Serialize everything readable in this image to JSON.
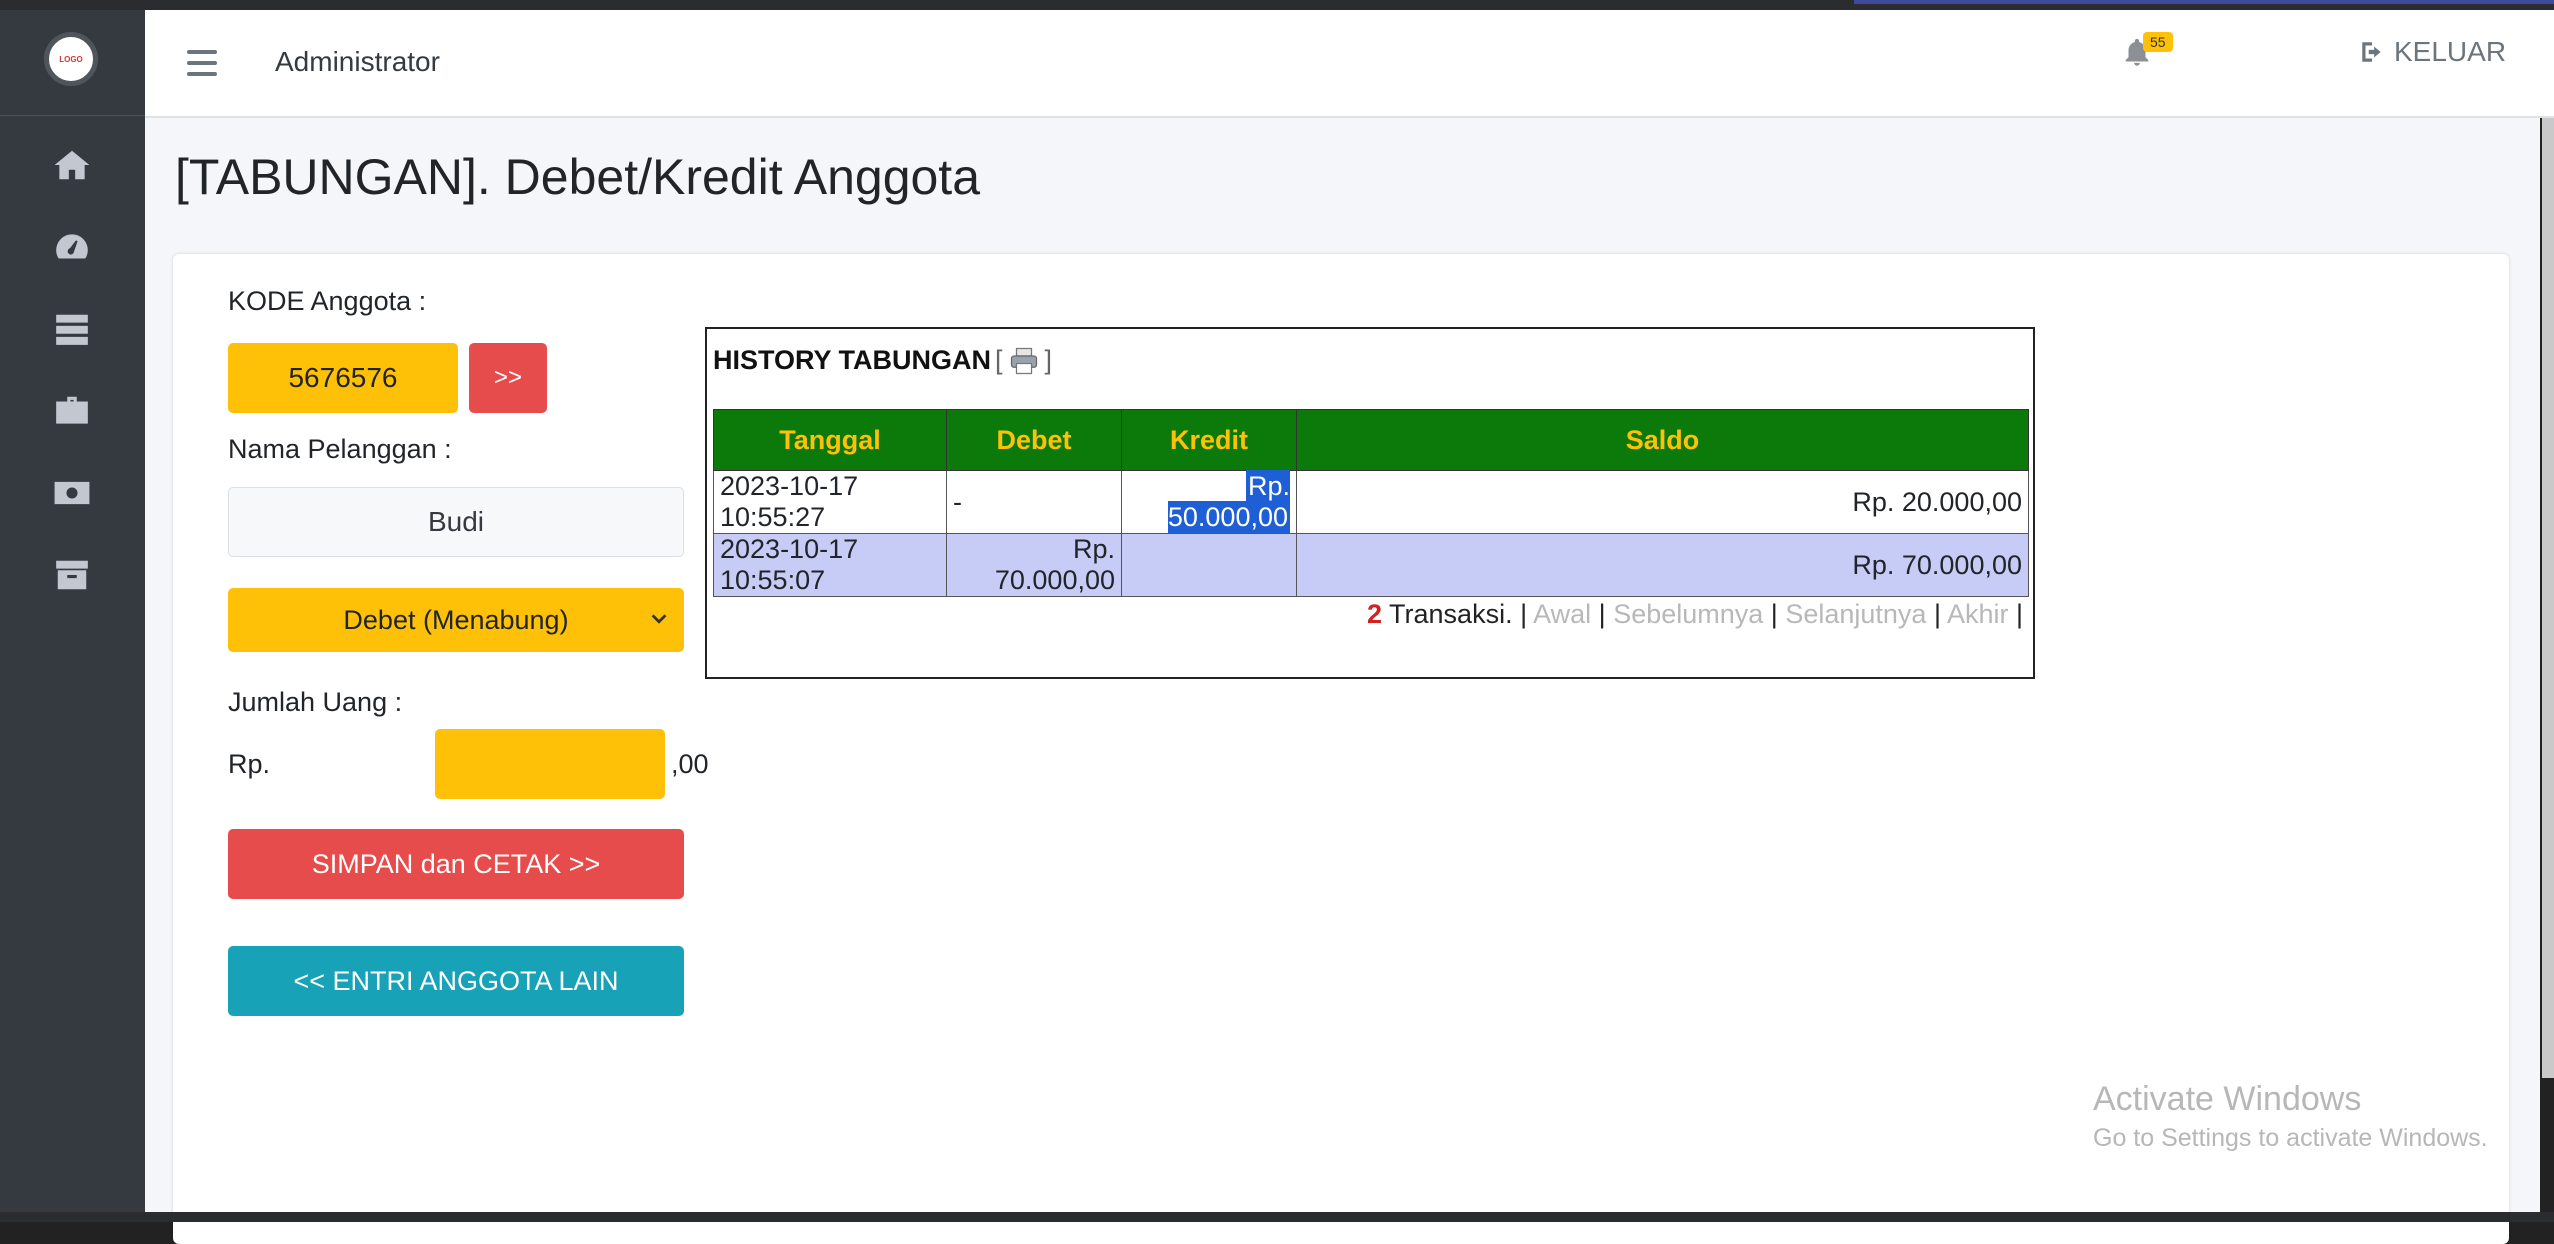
{
  "colors": {
    "sidebar": "#343a40",
    "warning": "#ffc107",
    "danger": "#e74c4c",
    "info": "#17a2b8",
    "table_header": "#0b7a0b",
    "selection": "#1f5fd6"
  },
  "sidebar": {
    "logo_text": "LOGO",
    "items": [
      {
        "icon": "home-icon"
      },
      {
        "icon": "dashboard-gauge-icon"
      },
      {
        "icon": "server-list-icon"
      },
      {
        "icon": "briefcase-icon"
      },
      {
        "icon": "money-bill-icon"
      },
      {
        "icon": "archive-box-icon"
      }
    ]
  },
  "topnav": {
    "user": "Administrator",
    "notif_count": "55",
    "logout_label": "KELUAR"
  },
  "page": {
    "title": "[TABUNGAN]. Debet/Kredit Anggota"
  },
  "form": {
    "kode_label": "KODE Anggota :",
    "kode_value": "5676576",
    "go_label": ">>",
    "nama_label": "Nama Pelanggan :",
    "nama_value": "Budi",
    "jenis_selected": "Debet (Menabung)",
    "jumlah_label": "Jumlah Uang :",
    "jumlah_prefix": "Rp.",
    "jumlah_value": "",
    "jumlah_suffix": ",00",
    "simpan_label": "SIMPAN dan CETAK >>",
    "entri_label": "<< ENTRI ANGGOTA LAIN"
  },
  "history": {
    "title": "HISTORY TABUNGAN",
    "title_bracket_open": "[",
    "title_bracket_close": "]",
    "columns": [
      "Tanggal",
      "Debet",
      "Kredit",
      "Saldo"
    ],
    "rows": [
      {
        "tanggal": "2023-10-17 10:55:27",
        "debet": "-",
        "kredit": "Rp. 50.000,00",
        "saldo": "Rp. 20.000,00"
      },
      {
        "tanggal": "2023-10-17 10:55:07",
        "debet": "Rp. 70.000,00",
        "kredit": "",
        "saldo": "Rp. 70.000,00"
      }
    ],
    "pager": {
      "count": "2",
      "count_label": " Transaksi.",
      "sep": " | ",
      "first": "Awal",
      "prev": "Sebelumnya",
      "next": "Selanjutnya",
      "last": "Akhir"
    }
  },
  "watermark": {
    "line1": "Activate Windows",
    "line2": "Go to Settings to activate Windows."
  }
}
